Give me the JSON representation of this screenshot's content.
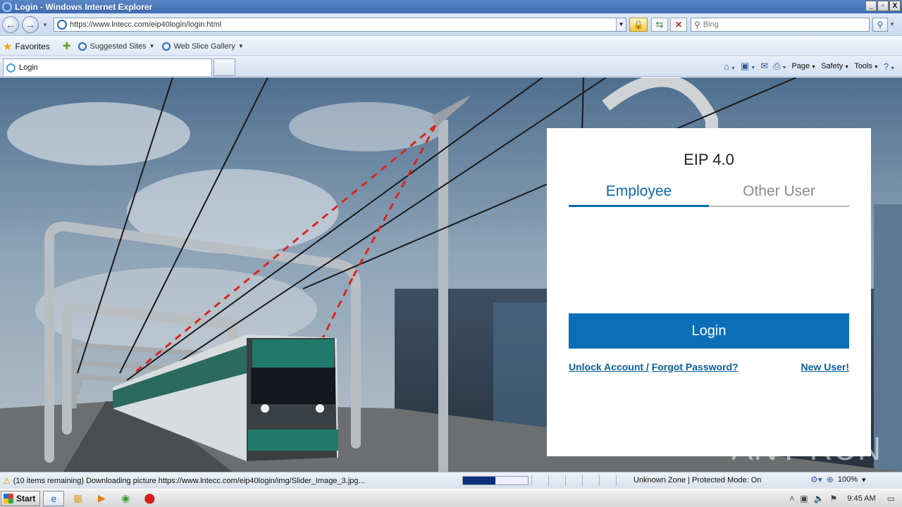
{
  "window": {
    "title": "Login - Windows Internet Explorer",
    "buttons": [
      "_",
      "▫",
      "X"
    ]
  },
  "addressbar": {
    "url": "https://www.lntecc.com/eip40login/login.html"
  },
  "search": {
    "placeholder": "Bing"
  },
  "favorites": {
    "label": "Favorites",
    "links": [
      "Suggested Sites",
      "Web Slice Gallery"
    ]
  },
  "tabs": [
    {
      "label": "Login"
    }
  ],
  "commandbar": {
    "items": [
      "Page",
      "Safety",
      "Tools"
    ]
  },
  "page": {
    "app_title": "EIP 4.0",
    "login_tabs": [
      {
        "label": "Employee",
        "active": true
      },
      {
        "label": "Other User",
        "active": false
      }
    ],
    "login_button": "Login",
    "links": {
      "unlock": "Unlock Account /",
      "forgot": "Forgot Password?",
      "new_user": "New User!"
    },
    "accent_color": "#0b6fb8",
    "watermark": "ANY RUN"
  },
  "statusbar": {
    "message": "(10 items remaining) Downloading picture https://www.lntecc.com/eip40login/img/Slider_Image_3.jpg...",
    "progress": 0.5,
    "zone": "Unknown Zone | Protected Mode: On",
    "zoom": "100%"
  },
  "taskbar": {
    "start": "Start",
    "clock": "9:45 AM"
  }
}
